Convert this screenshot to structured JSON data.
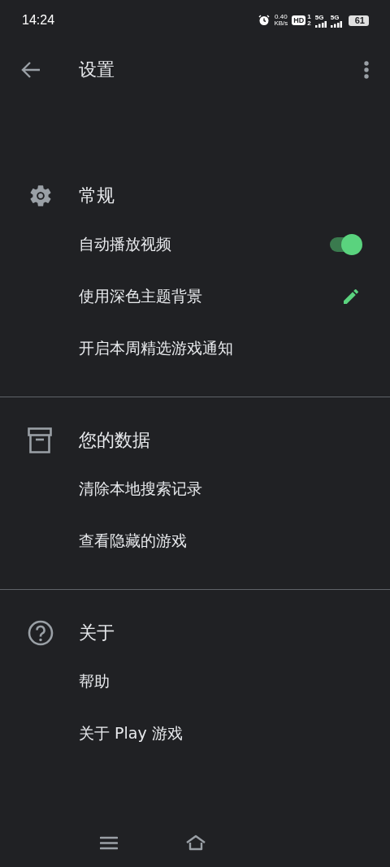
{
  "status_bar": {
    "time": "14:24",
    "speed": "0.40",
    "speed_unit": "KB/s",
    "hd": "HD",
    "sim_1": "1",
    "sim_2": "2",
    "network_1": "5G",
    "network_2": "5G",
    "battery": "61"
  },
  "toolbar": {
    "title": "设置"
  },
  "sections": [
    {
      "kind": "gear",
      "title": "常规",
      "items": [
        {
          "label": "自动播放视频",
          "kind": "toggle",
          "on": true
        },
        {
          "label": "使用深色主题背景",
          "kind": "edit"
        },
        {
          "label": "开启本周精选游戏通知",
          "kind": "plain"
        }
      ]
    },
    {
      "kind": "archive",
      "title": "您的数据",
      "items": [
        {
          "label": "清除本地搜索记录",
          "kind": "plain"
        },
        {
          "label": "查看隐藏的游戏",
          "kind": "plain"
        }
      ]
    },
    {
      "kind": "help",
      "title": "关于",
      "items": [
        {
          "label": "帮助",
          "kind": "plain"
        },
        {
          "label": "关于 Play 游戏",
          "kind": "plain"
        }
      ]
    }
  ]
}
